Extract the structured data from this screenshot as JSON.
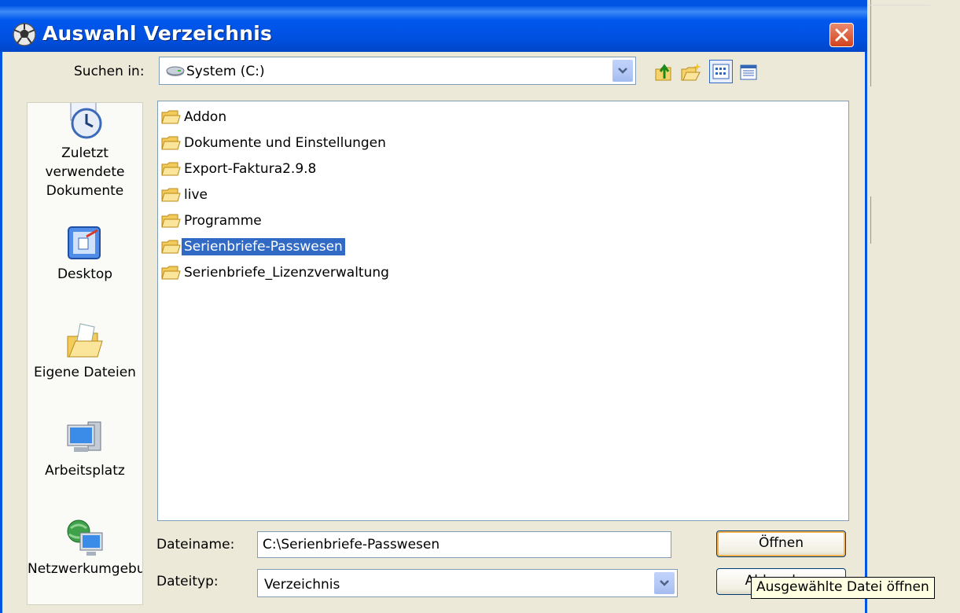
{
  "window": {
    "title": "Auswahl Verzeichnis",
    "close_icon": "close-icon"
  },
  "toolbar": {
    "lookin_label": "Suchen in:",
    "lookin_value": "System (C:)",
    "lookin_icon": "drive-icon",
    "icons": [
      "up-folder-icon",
      "new-folder-icon",
      "list-view-icon",
      "details-view-icon"
    ]
  },
  "places": [
    {
      "label": "Zuletzt verwendete Dokumente",
      "icon": "recent-documents-icon"
    },
    {
      "label": "Desktop",
      "icon": "desktop-icon"
    },
    {
      "label": "Eigene Dateien",
      "icon": "my-documents-icon"
    },
    {
      "label": "Arbeitsplatz",
      "icon": "my-computer-icon"
    },
    {
      "label": "Netzwerkumgebu",
      "icon": "network-icon"
    }
  ],
  "files": [
    {
      "name": "Addon",
      "icon": "folder-icon",
      "selected": false
    },
    {
      "name": "Dokumente und Einstellungen",
      "icon": "folder-icon",
      "selected": false
    },
    {
      "name": "Export-Faktura2.9.8",
      "icon": "folder-icon",
      "selected": false
    },
    {
      "name": "live",
      "icon": "folder-icon",
      "selected": false
    },
    {
      "name": "Programme",
      "icon": "folder-icon",
      "selected": false
    },
    {
      "name": "Serienbriefe-Passwesen",
      "icon": "folder-icon",
      "selected": true
    },
    {
      "name": "Serienbriefe_Lizenzverwaltung",
      "icon": "folder-icon",
      "selected": false
    }
  ],
  "form": {
    "filename_label": "Dateiname:",
    "filename_value": "C:\\Serienbriefe-Passwesen",
    "filetype_label": "Dateityp:",
    "filetype_value": "Verzeichnis"
  },
  "buttons": {
    "open": "Öffnen",
    "cancel": "Abbrechen"
  },
  "tooltip": "Ausgewählte Datei öffnen",
  "colors": {
    "titlebar": "#0054e3",
    "selection": "#316ac5",
    "close_button": "#d2431c",
    "tooltip_bg": "#ffffe1"
  }
}
